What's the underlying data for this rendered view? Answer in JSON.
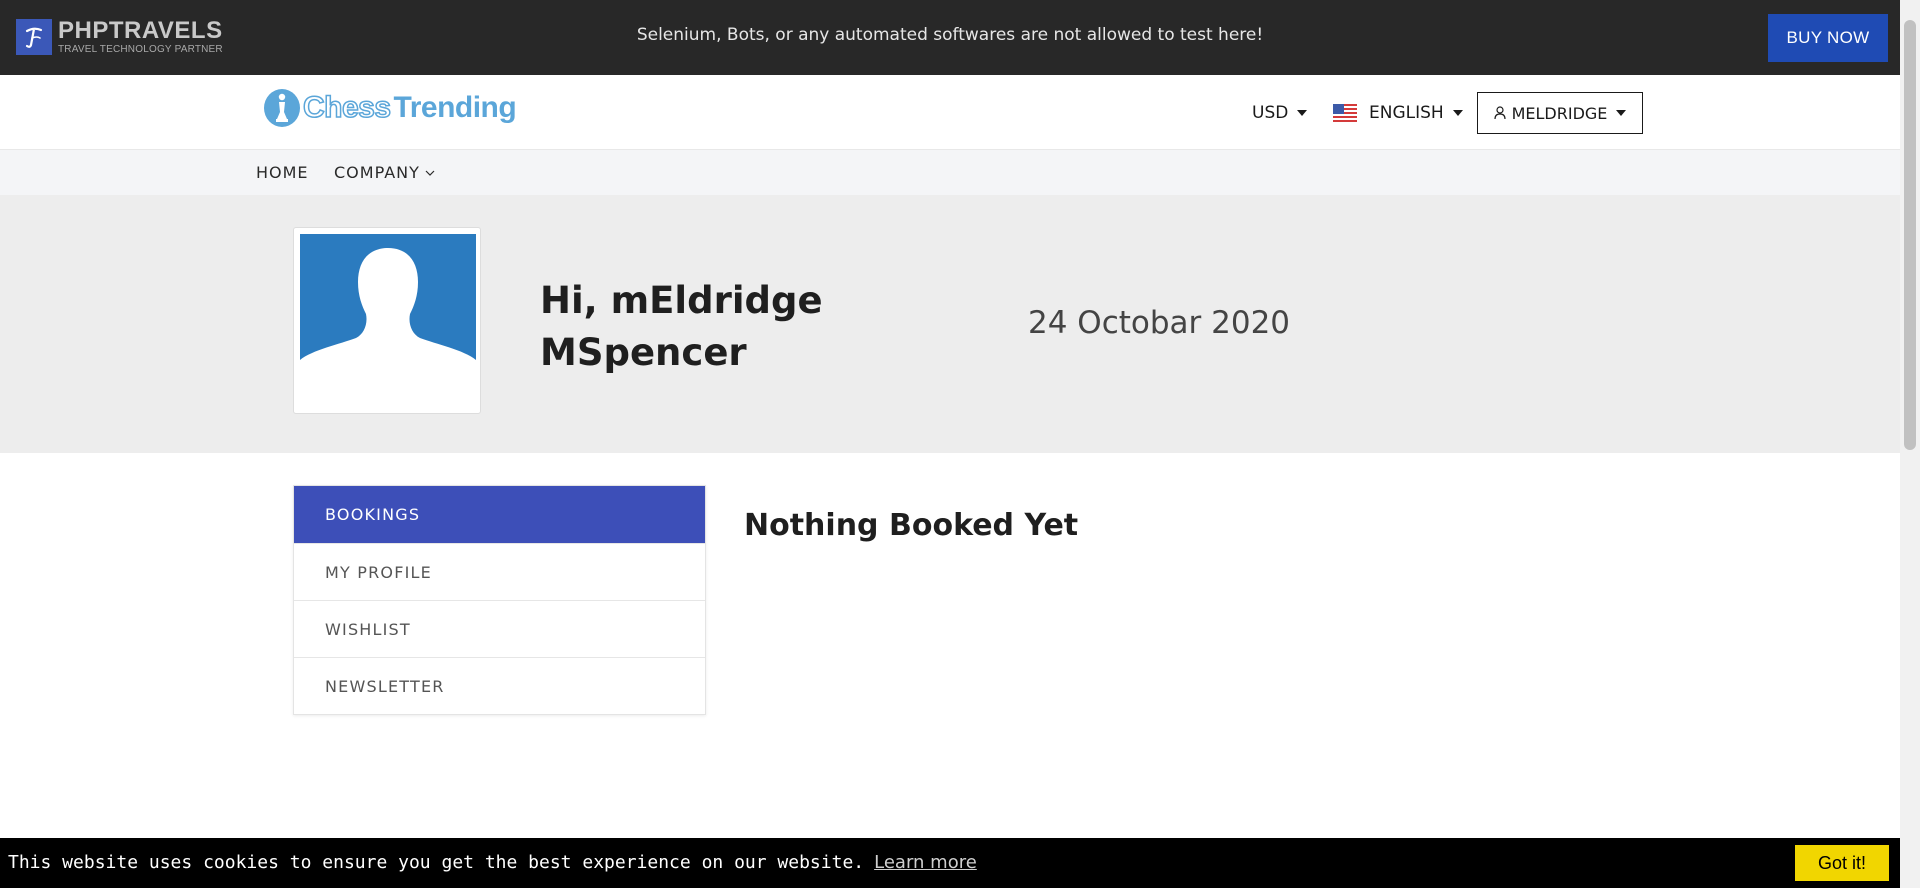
{
  "topbar": {
    "brand_name": "PHPTRAVELS",
    "brand_tagline": "TRAVEL TECHNOLOGY PARTNER",
    "notice": "Selenium, Bots, or any automated softwares are not allowed to test here!",
    "buy_now": "BUY NOW"
  },
  "header": {
    "logo_part1": "Chess",
    "logo_part2": "Trending",
    "currency": "USD",
    "language": "ENGLISH",
    "user": "MELDRIDGE"
  },
  "nav": {
    "items": [
      {
        "label": "HOME"
      },
      {
        "label": "COMPANY"
      }
    ]
  },
  "profile": {
    "greeting_line1": "Hi, mEldridge",
    "greeting_line2": "MSpencer",
    "date": "24 Octobar 2020"
  },
  "sidebar": {
    "items": [
      {
        "label": "BOOKINGS",
        "active": true
      },
      {
        "label": "MY PROFILE",
        "active": false
      },
      {
        "label": "WISHLIST",
        "active": false
      },
      {
        "label": "NEWSLETTER",
        "active": false
      }
    ]
  },
  "main": {
    "empty_message": "Nothing Booked Yet"
  },
  "cookie": {
    "message": "This website uses cookies to ensure you get the best experience on our website.",
    "learn_more": "Learn more",
    "accept": "Got it!"
  },
  "colors": {
    "topbar_bg": "#282828",
    "buy_now_bg": "#1f4bb4",
    "sidebar_active_bg": "#3d4fb8",
    "avatar_bg": "#2b7bbf",
    "cookie_button_bg": "#f1d600",
    "logo_blue": "#5ba6d9"
  },
  "icons": [
    "phptravels-logo-icon",
    "chess-logo-icon",
    "us-flag-icon",
    "user-icon",
    "chevron-down-icon",
    "caret-down-icon",
    "avatar-silhouette-icon"
  ]
}
